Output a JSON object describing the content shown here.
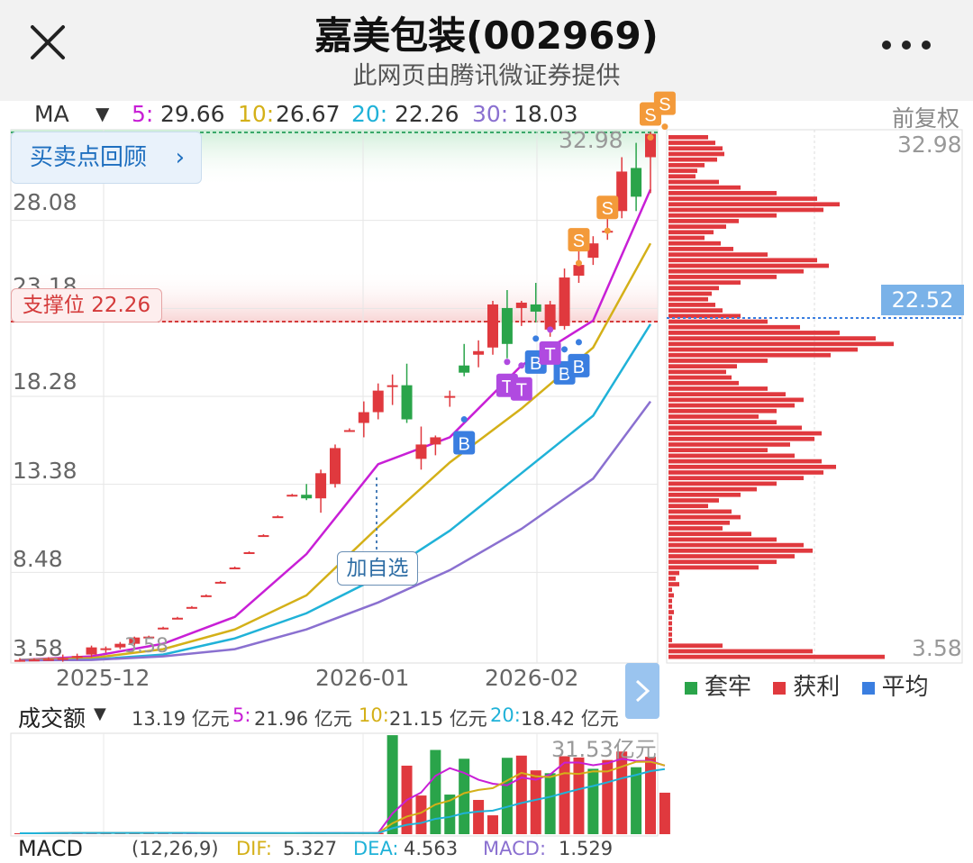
{
  "header": {
    "title": "嘉美包装(002969)",
    "subtitle": "此网页由腾讯微证券提供"
  },
  "ma_row": {
    "indicator": "MA",
    "ma5_label": "5:",
    "ma5_value": "29.66",
    "ma10_label": "10:",
    "ma10_value": "26.67",
    "ma20_label": "20:",
    "ma20_value": "22.26",
    "ma30_label": "30:",
    "ma30_value": "18.03",
    "adjust": "前复权"
  },
  "price_chart": {
    "y_labels": [
      "28.08",
      "18.28",
      "13.38",
      "8.48",
      "3.58"
    ],
    "hidden_label": "23.18",
    "max_label": "32.98",
    "min_label": "3.58",
    "x_labels": [
      "2025-12",
      "2026-01",
      "2026-02"
    ],
    "review_button": "买卖点回顾",
    "support_label": "支撑位 22.26",
    "watch_button": "加自选",
    "buy_mark": "B",
    "sell_mark": "S",
    "t_mark": "T"
  },
  "profile": {
    "max_label": "32.98",
    "min_label": "3.58",
    "price_badge": "22.52",
    "legend": [
      {
        "label": "套牢",
        "color": "#2aa44a"
      },
      {
        "label": "获利",
        "color": "#e0393e"
      },
      {
        "label": "平均",
        "color": "#3a7ee0"
      }
    ]
  },
  "volume": {
    "title": "成交额",
    "current": "13.19 亿元",
    "ma5_label": "5:",
    "ma5_value": "21.96 亿元",
    "ma10_label": "10:",
    "ma10_value": "21.15 亿元",
    "ma20_label": "20:",
    "ma20_value": "18.42 亿元",
    "max_label": "31.53亿元"
  },
  "macd": {
    "title": "MACD",
    "params": "(12,26,9)",
    "dif_label": "DIF:",
    "dif_value": "5.327",
    "dea_label": "DEA:",
    "dea_value": "4.563",
    "macd_label": "MACD:",
    "macd_value": "1.529"
  },
  "colors": {
    "up": "#e0393e",
    "down": "#2aa44a",
    "ma5": "#c81fd6",
    "ma10": "#d4b018",
    "ma20": "#20b2d8",
    "ma30": "#8a70d0",
    "buy": "#3a7ee0",
    "sell": "#f39a3a",
    "t": "#b04ae0"
  },
  "chart_data": {
    "type": "candlestick",
    "y_axis": [
      3.58,
      32.98
    ],
    "support_level": 22.26,
    "candles": [
      {
        "o": 3.58,
        "h": 3.7,
        "l": 3.5,
        "c": 3.6
      },
      {
        "o": 3.6,
        "h": 3.7,
        "l": 3.55,
        "c": 3.62
      },
      {
        "o": 3.62,
        "h": 3.75,
        "l": 3.55,
        "c": 3.65
      },
      {
        "o": 3.65,
        "h": 3.9,
        "l": 3.5,
        "c": 3.7
      },
      {
        "o": 3.75,
        "h": 3.95,
        "l": 3.6,
        "c": 3.82
      },
      {
        "o": 3.9,
        "h": 4.4,
        "l": 3.75,
        "c": 4.3
      },
      {
        "o": 4.2,
        "h": 4.35,
        "l": 4.0,
        "c": 4.25
      },
      {
        "o": 4.3,
        "h": 4.6,
        "l": 4.2,
        "c": 4.5
      },
      {
        "o": 4.5,
        "h": 4.9,
        "l": 4.4,
        "c": 4.85
      },
      {
        "o": 4.85,
        "h": 4.95,
        "l": 4.8,
        "c": 4.9
      },
      {
        "o": 5.4,
        "h": 5.45,
        "l": 5.3,
        "c": 5.4
      },
      {
        "o": 5.95,
        "h": 6.0,
        "l": 5.9,
        "c": 5.95
      },
      {
        "o": 6.55,
        "h": 6.6,
        "l": 6.5,
        "c": 6.55
      },
      {
        "o": 7.2,
        "h": 7.25,
        "l": 7.15,
        "c": 7.2
      },
      {
        "o": 7.95,
        "h": 8.0,
        "l": 7.9,
        "c": 7.95
      },
      {
        "o": 8.75,
        "h": 8.8,
        "l": 8.7,
        "c": 8.75
      },
      {
        "o": 9.6,
        "h": 9.65,
        "l": 9.55,
        "c": 9.6
      },
      {
        "o": 10.55,
        "h": 10.6,
        "l": 10.5,
        "c": 10.55
      },
      {
        "o": 11.6,
        "h": 11.65,
        "l": 11.55,
        "c": 11.6
      },
      {
        "o": 12.75,
        "h": 12.85,
        "l": 12.7,
        "c": 12.8
      },
      {
        "o": 12.8,
        "h": 13.4,
        "l": 12.5,
        "c": 12.6
      },
      {
        "o": 12.6,
        "h": 14.2,
        "l": 11.8,
        "c": 14.0
      },
      {
        "o": 13.4,
        "h": 15.6,
        "l": 13.2,
        "c": 15.4
      },
      {
        "o": 16.4,
        "h": 16.5,
        "l": 16.3,
        "c": 16.4
      },
      {
        "o": 16.8,
        "h": 18.0,
        "l": 16.0,
        "c": 17.4
      },
      {
        "o": 17.4,
        "h": 19.0,
        "l": 17.0,
        "c": 18.6
      },
      {
        "o": 18.8,
        "h": 19.5,
        "l": 17.8,
        "c": 18.9
      },
      {
        "o": 18.9,
        "h": 20.1,
        "l": 16.8,
        "c": 17.0
      },
      {
        "o": 14.8,
        "h": 16.6,
        "l": 14.2,
        "c": 15.6
      },
      {
        "o": 15.6,
        "h": 16.1,
        "l": 15.0,
        "c": 16.0
      },
      {
        "o": 18.2,
        "h": 18.6,
        "l": 17.7,
        "c": 18.3
      },
      {
        "o": 20.0,
        "h": 21.2,
        "l": 19.4,
        "c": 19.6
      },
      {
        "o": 20.6,
        "h": 21.4,
        "l": 19.9,
        "c": 20.8
      },
      {
        "o": 21.0,
        "h": 23.6,
        "l": 20.6,
        "c": 23.4
      },
      {
        "o": 23.2,
        "h": 24.2,
        "l": 20.4,
        "c": 21.2
      },
      {
        "o": 23.2,
        "h": 23.6,
        "l": 22.2,
        "c": 23.5
      },
      {
        "o": 23.4,
        "h": 24.6,
        "l": 22.4,
        "c": 23.0
      },
      {
        "o": 22.0,
        "h": 23.6,
        "l": 21.6,
        "c": 23.4
      },
      {
        "o": 22.2,
        "h": 25.4,
        "l": 22.0,
        "c": 24.9
      },
      {
        "o": 25.0,
        "h": 27.0,
        "l": 24.6,
        "c": 25.6
      },
      {
        "o": 26.0,
        "h": 27.2,
        "l": 25.6,
        "c": 26.8
      },
      {
        "o": 27.4,
        "h": 28.8,
        "l": 27.0,
        "c": 27.5
      },
      {
        "o": 28.6,
        "h": 31.6,
        "l": 28.2,
        "c": 30.8
      },
      {
        "o": 31.0,
        "h": 32.4,
        "l": 28.6,
        "c": 29.4
      },
      {
        "o": 31.6,
        "h": 33.0,
        "l": 29.6,
        "c": 32.9
      }
    ],
    "series": [
      {
        "name": "5",
        "points": [
          [
            0,
            3.6
          ],
          [
            5,
            3.8
          ],
          [
            10,
            4.5
          ],
          [
            15,
            6.0
          ],
          [
            20,
            9.5
          ],
          [
            25,
            14.5
          ],
          [
            30,
            16.0
          ],
          [
            35,
            20.0
          ],
          [
            40,
            22.5
          ],
          [
            44,
            29.8
          ]
        ]
      },
      {
        "name": "10",
        "points": [
          [
            0,
            3.6
          ],
          [
            5,
            3.7
          ],
          [
            10,
            4.2
          ],
          [
            15,
            5.3
          ],
          [
            20,
            7.2
          ],
          [
            25,
            11.0
          ],
          [
            30,
            14.6
          ],
          [
            35,
            17.6
          ],
          [
            40,
            21.0
          ],
          [
            44,
            26.8
          ]
        ]
      },
      {
        "name": "20",
        "points": [
          [
            0,
            3.58
          ],
          [
            5,
            3.62
          ],
          [
            10,
            3.9
          ],
          [
            15,
            4.8
          ],
          [
            20,
            6.2
          ],
          [
            25,
            8.2
          ],
          [
            30,
            10.8
          ],
          [
            35,
            14.0
          ],
          [
            40,
            17.2
          ],
          [
            44,
            22.3
          ]
        ]
      },
      {
        "name": "30",
        "points": [
          [
            0,
            3.58
          ],
          [
            5,
            3.6
          ],
          [
            10,
            3.8
          ],
          [
            15,
            4.2
          ],
          [
            20,
            5.3
          ],
          [
            25,
            6.8
          ],
          [
            30,
            8.6
          ],
          [
            35,
            10.9
          ],
          [
            40,
            13.7
          ],
          [
            44,
            18.0
          ]
        ]
      }
    ],
    "signals": [
      {
        "i": 31,
        "type": "B"
      },
      {
        "i": 36,
        "type": "B"
      },
      {
        "i": 38,
        "type": "B"
      },
      {
        "i": 39,
        "type": "B"
      },
      {
        "i": 34,
        "type": "T"
      },
      {
        "i": 35,
        "type": "T"
      },
      {
        "i": 37,
        "type": "T"
      },
      {
        "i": 39,
        "type": "S"
      },
      {
        "i": 41,
        "type": "S"
      },
      {
        "i": 44,
        "type": "S"
      },
      {
        "i": 45,
        "type": "S"
      }
    ],
    "volume": [
      0.3,
      0.3,
      0.4,
      0.5,
      0.4,
      0.4,
      0.4,
      0.5,
      0.4,
      0.4,
      0.3,
      0.3,
      0.3,
      0.3,
      0.3,
      0.3,
      0.3,
      0.3,
      0.3,
      0.3,
      0.4,
      0.4,
      0.4,
      0.3,
      0.3,
      0.4,
      31.5,
      21.8,
      12.3,
      26.8,
      12.6,
      24.0,
      10.9,
      6.0,
      24.3,
      25.0,
      20.3,
      19.4,
      24.8,
      24.4,
      20.8,
      23.6,
      26.3,
      21.3,
      24.6,
      13.2
    ],
    "volume_up": [
      true,
      true,
      true,
      true,
      true,
      true,
      true,
      true,
      true,
      true,
      true,
      true,
      true,
      true,
      true,
      true,
      true,
      true,
      true,
      true,
      true,
      true,
      true,
      true,
      true,
      true,
      false,
      true,
      true,
      false,
      false,
      false,
      true,
      true,
      false,
      true,
      true,
      false,
      true,
      true,
      false,
      true,
      true,
      false,
      true,
      true
    ],
    "volume_ma_max": 31.53,
    "profile_bins": [
      44,
      52,
      60,
      62,
      54,
      40,
      32,
      30,
      56,
      80,
      120,
      165,
      190,
      172,
      120,
      78,
      64,
      50,
      40,
      58,
      72,
      110,
      165,
      178,
      150,
      120,
      80,
      56,
      48,
      44,
      52,
      60,
      80,
      110,
      146,
      190,
      230,
      250,
      210,
      180,
      110,
      76,
      64,
      70,
      78,
      110,
      130,
      150,
      140,
      120,
      100,
      120,
      148,
      170,
      162,
      135,
      110,
      140,
      170,
      186,
      172,
      150,
      120,
      98,
      80,
      56,
      44,
      70,
      80,
      68,
      60,
      92,
      120,
      150,
      160,
      140,
      120,
      100,
      12,
      8,
      12,
      4,
      6,
      4,
      4,
      6,
      4,
      4,
      4,
      4,
      4,
      60,
      160,
      240
    ]
  }
}
